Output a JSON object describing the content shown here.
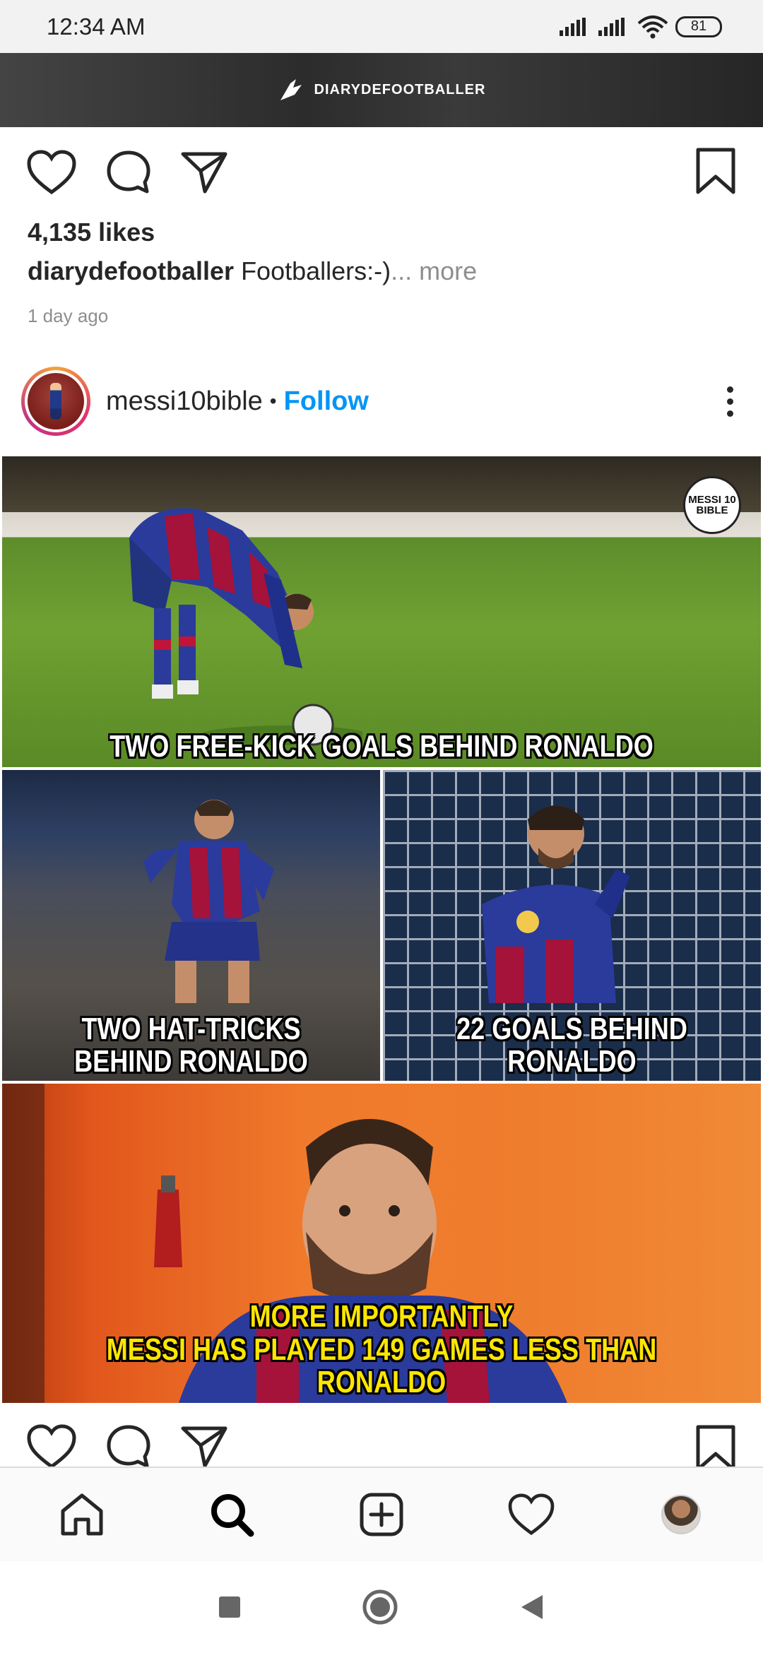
{
  "status_bar": {
    "time": "12:34 AM",
    "battery": "81"
  },
  "previous_post": {
    "brand": "DIARYDEFOOTBALLER",
    "likes": "4,135 likes",
    "caption_user": "diarydefootballer",
    "caption_text": " Footballers:-)",
    "caption_more": "... more",
    "time_ago": "1 day ago"
  },
  "post": {
    "username": "messi10bible",
    "separator": "•",
    "follow_label": "Follow",
    "badge": "MESSI 10 BIBLE",
    "captions": {
      "panel1": "TWO FREE-KICK GOALS BEHIND RONALDO",
      "panel2_line1": "TWO HAT-TRICKS",
      "panel2_line2": "BEHIND RONALDO",
      "panel3": "22 GOALS BEHIND RONALDO",
      "panel4_line1": "MORE IMPORTANTLY",
      "panel4_line2": "MESSI HAS PLAYED 149 GAMES LESS THAN RONALDO"
    }
  },
  "icons": {
    "like": "heart-icon",
    "comment": "comment-icon",
    "share": "paper-plane-icon",
    "save": "bookmark-icon",
    "more": "more-vertical-icon"
  },
  "bottom_nav": [
    "home-icon",
    "search-icon",
    "add-post-icon",
    "activity-heart-icon",
    "profile-avatar"
  ],
  "colors": {
    "link": "#0095f6",
    "text": "#262626",
    "muted": "#8e8e8e",
    "caption_yellow": "#ffe600"
  }
}
